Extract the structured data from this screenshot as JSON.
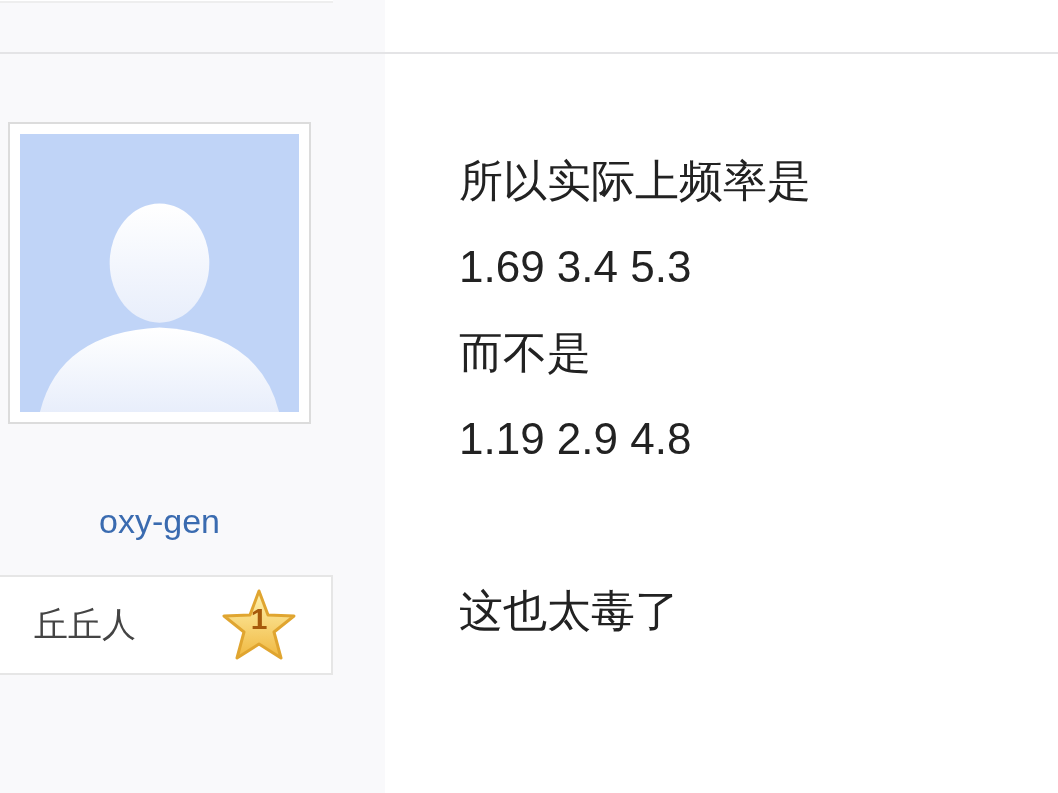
{
  "author": {
    "username": "oxy-gen",
    "rank": {
      "title": "丘丘人",
      "level_badge": "1"
    }
  },
  "post": {
    "paragraphs": [
      {
        "lines": [
          "所以实际上频率是",
          "1.69 3.4 5.3",
          "而不是",
          "1.19 2.9 4.8"
        ]
      },
      {
        "lines": [
          "这也太毒了"
        ]
      }
    ]
  }
}
